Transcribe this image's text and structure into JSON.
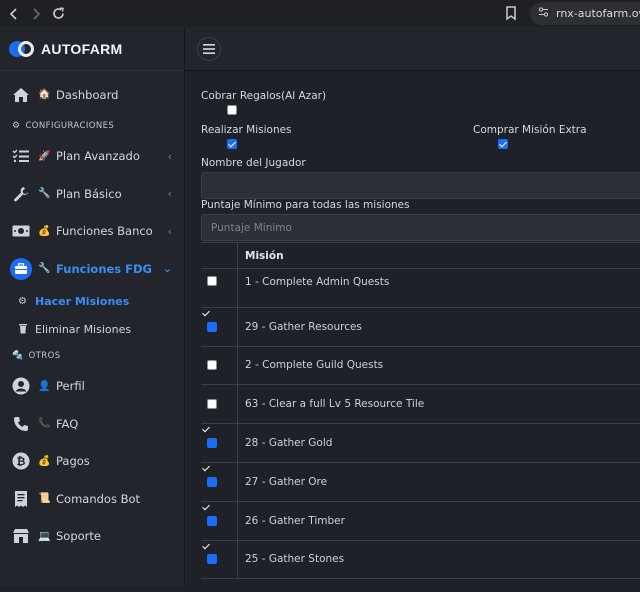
{
  "browser": {
    "url": "rnx-autofarm.ovh/"
  },
  "brand": {
    "name": "AUTOFARM"
  },
  "sidebar": {
    "dashboard": {
      "emoji": "🏠",
      "label": "Dashboard"
    },
    "section_config": {
      "emoji": "⚙",
      "label": "CONFIGURACIONES"
    },
    "plan_avanzado": {
      "emoji": "🚀",
      "label": "Plan Avanzado"
    },
    "plan_basico": {
      "emoji": "🔧",
      "label": "Plan Básico"
    },
    "funciones_banco": {
      "emoji": "💰",
      "label": "Funciones Banco"
    },
    "funciones_fdg": {
      "emoji": "🔧",
      "label": "Funciones FDG"
    },
    "hacer_misiones": {
      "label": "Hacer Misiones"
    },
    "eliminar_misiones": {
      "label": "Eliminar Misiones"
    },
    "section_otros": {
      "emoji": "🔩",
      "label": "OTROS"
    },
    "perfil": {
      "emoji": "👤",
      "label": "Perfil"
    },
    "faq": {
      "emoji": "📞",
      "label": "FAQ"
    },
    "pagos": {
      "emoji": "💰",
      "label": "Pagos"
    },
    "comandos_bot": {
      "emoji": "📜",
      "label": "Comandos Bot"
    },
    "soporte": {
      "emoji": "💻",
      "label": "Soporte"
    }
  },
  "form": {
    "cobrar_regalos": {
      "label": "Cobrar Regalos(Al Azar)",
      "checked": false
    },
    "realizar_misiones": {
      "label": "Realizar Misiones",
      "checked": true
    },
    "comprar_mision_extra": {
      "label": "Comprar Misión Extra",
      "checked": true
    },
    "nombre_jugador": {
      "label": "Nombre del Jugador",
      "value": ""
    },
    "puntaje_minimo": {
      "label": "Puntaje Mínimo para todas las misiones",
      "placeholder": "Puntaje Minimo"
    }
  },
  "table": {
    "header": "Misión",
    "rows": [
      {
        "label": "1 - Complete Admin Quests",
        "checked": false
      },
      {
        "label": "29 - Gather Resources",
        "checked": true
      },
      {
        "label": "2 - Complete Guild Quests",
        "checked": false
      },
      {
        "label": "63 - Clear a full Lv 5 Resource Tile",
        "checked": false
      },
      {
        "label": "28 - Gather Gold",
        "checked": true
      },
      {
        "label": "27 - Gather Ore",
        "checked": true
      },
      {
        "label": "26 - Gather Timber",
        "checked": true
      },
      {
        "label": "25 - Gather Stones",
        "checked": true
      }
    ]
  },
  "colors": {
    "accent": "#1b6ef3",
    "sidebar_bg": "#22262c",
    "main_bg": "#1e2127"
  }
}
